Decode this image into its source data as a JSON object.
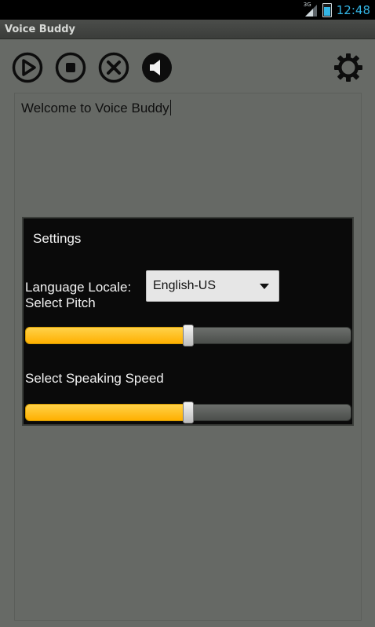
{
  "status_bar": {
    "network": "3G",
    "time": "12:48",
    "battery_level": 0.8
  },
  "app": {
    "title": "Voice Buddy"
  },
  "toolbar": {
    "icons": [
      "play-icon",
      "stop-icon",
      "cancel-icon",
      "speaker-icon",
      "settings-gear-icon"
    ]
  },
  "editor": {
    "text": "Welcome to Voice Buddy"
  },
  "settings_dialog": {
    "title": "Settings",
    "language_label": "Language Locale:",
    "language_value": "English-US",
    "pitch_label": "Select Pitch",
    "pitch_value": 0.5,
    "speed_label": "Select Speaking Speed",
    "speed_value": 0.5
  },
  "colors": {
    "accent_blue": "#33b5e5",
    "slider_fill": "#ffb000",
    "background": "#676a66"
  }
}
